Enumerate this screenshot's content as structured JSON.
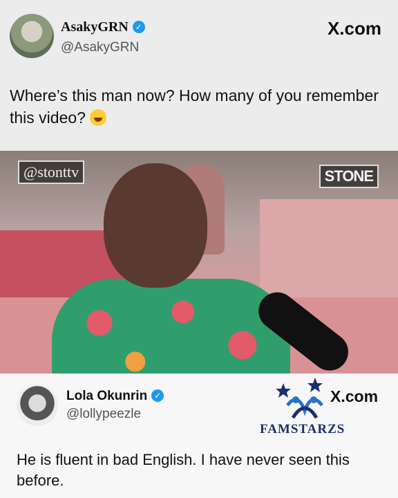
{
  "first_tweet": {
    "name": "AsakyGRN",
    "handle": "@AsakyGRN",
    "brand": "X.com",
    "text": "Where’s this man now? How many of you remember this video?",
    "emoji": "laughing-with-tears"
  },
  "video": {
    "watermark_left": "@stonttv",
    "watermark_right": "STONE"
  },
  "reply_tweet": {
    "name": "Lola Okunrin",
    "handle": "@lollypeezle",
    "brand": "X.com",
    "logo_text": "FAMSTARZS",
    "text": "He is fluent in bad English. I have never seen this before."
  },
  "colors": {
    "verified": "#1d9bf0",
    "logo": "#1a2e6e"
  }
}
